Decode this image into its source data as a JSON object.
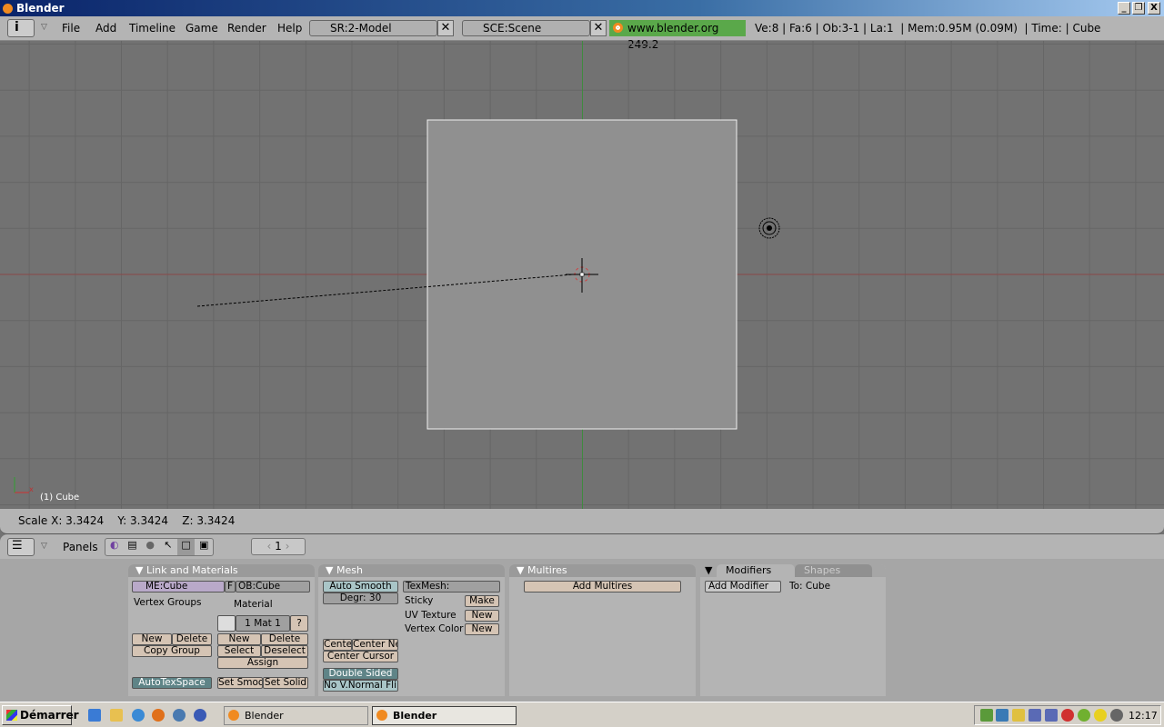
{
  "window": {
    "title": "Blender",
    "controls": [
      "_",
      "❐",
      "X"
    ]
  },
  "topbar": {
    "menus": [
      "File",
      "Add",
      "Timeline",
      "Game",
      "Render",
      "Help"
    ],
    "screen": "SR:2-Model",
    "scene": "SCE:Scene",
    "version": "www.blender.org 249.2",
    "stats": "Ve:8 | Fa:6 | Ob:3-1 | La:1  | Mem:0.95M (0.09M)  | Time: | Cube"
  },
  "viewport": {
    "object_label": "(1) Cube",
    "axis_x": "x"
  },
  "infobar": {
    "text": "Scale X: 3.3424    Y: 3.3424    Z: 3.3424"
  },
  "buttons_header": {
    "panels_label": "Panels",
    "frame": "1"
  },
  "link_materials": {
    "title": "Link and Materials",
    "mesh": "ME:Cube",
    "f": "F",
    "object": "OB:Cube",
    "vertex_groups": "Vertex Groups",
    "material": "Material",
    "mat_slot": "1 Mat 1",
    "help": "?",
    "vg_new": "New",
    "vg_delete": "Delete",
    "copy_group": "Copy Group",
    "mat_new": "New",
    "mat_delete": "Delete",
    "select": "Select",
    "deselect": "Deselect",
    "assign": "Assign",
    "autotexspace": "AutoTexSpace",
    "set_smooth": "Set Smoo",
    "set_solid": "Set Solid"
  },
  "mesh": {
    "title": "Mesh",
    "auto_smooth": "Auto Smooth",
    "degr": "Degr: 30",
    "texmesh": "TexMesh:",
    "sticky": "Sticky",
    "make": "Make",
    "uv_texture": "UV Texture",
    "uv_new": "New",
    "vertex_color": "Vertex Color",
    "vc_new": "New",
    "centre": "Cente",
    "center_new": "Center Ne",
    "center_cursor": "Center Cursor",
    "double_sided": "Double Sided",
    "no_vnormal_flip": "No V.Normal Flip"
  },
  "multires": {
    "title": "Multires",
    "add": "Add Multires"
  },
  "modifiers": {
    "tab_modifiers": "Modifiers",
    "tab_shapes": "Shapes",
    "add": "Add Modifier",
    "to": "To: Cube"
  },
  "taskbar": {
    "start": "Démarrer",
    "tasks": [
      "Blender",
      "Blender"
    ],
    "clock": "12:17"
  },
  "colors": {
    "viewport_bg": "#727272",
    "grid": "#666666",
    "cube": "#909090",
    "status_green": "#5aa84a",
    "button": "#d5c4b4"
  }
}
